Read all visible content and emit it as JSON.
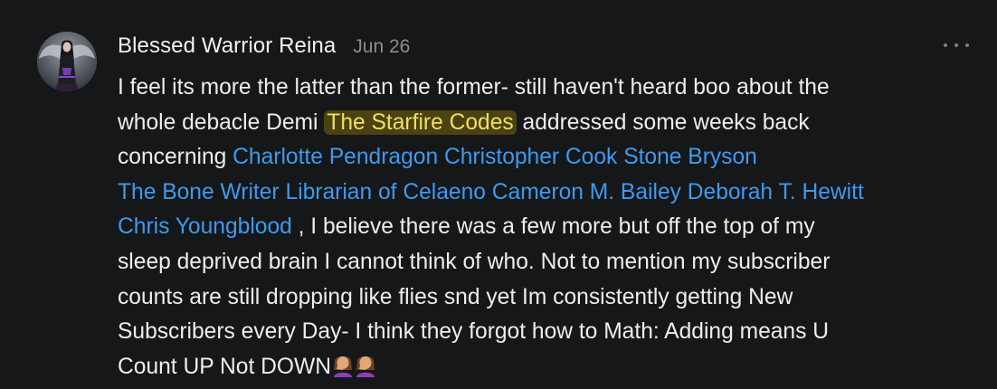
{
  "comment": {
    "author": "Blessed Warrior Reina",
    "date": "Jun 26",
    "avatar_icon": "avatar-image",
    "more_icon": "more-horizontal-icon",
    "text": {
      "l1": "I feel its more the latter than the former- still haven't heard boo about the",
      "l2_a": "whole debacle Demi ",
      "l2_highlight": "The Starfire Codes",
      "l2_b": " addressed some weeks back",
      "l3_a": "concerning ",
      "l4_m1": "The Bone Writer",
      "l4_m2": "Librarian of Celaeno",
      "l4_m3": "Cameron M. Bailey",
      "l4_m4": "Deborah T. Hewitt",
      "l5_m1": "Chris Youngblood",
      "l5_b": " , I believe there was a few more but off the top of my",
      "l6": "sleep deprived brain I cannot think of who. Not to mention my subscriber",
      "l7": "counts are still dropping like flies snd yet Im consistently getting New",
      "l8": "Subscribers every Day- I think they forgot how to Math: Adding means U",
      "l9": "Count UP Not DOWN",
      "emoji_icon": "woman-facepalming-emoji"
    },
    "mentions": [
      "Charlotte Pendragon",
      "Christopher Cook",
      "Stone Bryson",
      "The Bone Writer",
      "Librarian of Celaeno",
      "Cameron M. Bailey",
      "Deborah T. Hewitt",
      "Chris Youngblood"
    ]
  },
  "colors": {
    "background": "#161719",
    "mention": "#3d9af0",
    "highlight_bg": "#4a4214",
    "highlight_text": "#f2df5b",
    "meta": "#8b8d92"
  }
}
